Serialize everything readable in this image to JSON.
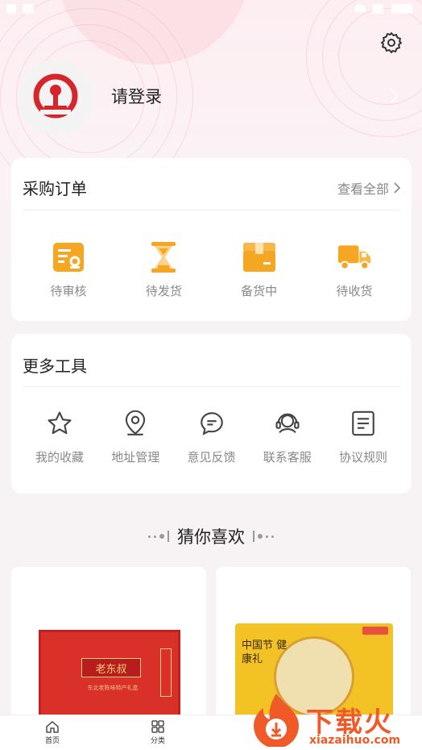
{
  "profile": {
    "login_label": "请登录"
  },
  "orders": {
    "title": "采购订单",
    "view_all": "查看全部",
    "items": [
      {
        "label": "待审核",
        "icon": "review-icon"
      },
      {
        "label": "待发货",
        "icon": "hourglass-icon"
      },
      {
        "label": "备货中",
        "icon": "box-icon"
      },
      {
        "label": "待收货",
        "icon": "truck-icon"
      }
    ]
  },
  "tools": {
    "title": "更多工具",
    "items": [
      {
        "label": "我的收藏",
        "icon": "star-icon"
      },
      {
        "label": "地址管理",
        "icon": "location-icon"
      },
      {
        "label": "意见反馈",
        "icon": "chat-icon"
      },
      {
        "label": "联系客服",
        "icon": "headset-icon"
      },
      {
        "label": "协议规则",
        "icon": "document-icon"
      }
    ]
  },
  "recommend": {
    "title": "猜你喜欢"
  },
  "products": [
    {
      "name": "老东叔",
      "sub": "东北老陈味特产礼盒"
    },
    {
      "name": "中国节 健康礼"
    }
  ],
  "bottom_nav": {
    "items": [
      {
        "label": "首页",
        "icon": "home-icon"
      },
      {
        "label": "分类",
        "icon": "grid-icon"
      }
    ]
  },
  "watermark": {
    "text": "下载火",
    "sub": "xiazaihuo.com"
  },
  "colors": {
    "accent": "#f5a623",
    "logo_red": "#d7252c",
    "card_bg": "#ffffff",
    "page_bg": "#f7f2f4"
  }
}
